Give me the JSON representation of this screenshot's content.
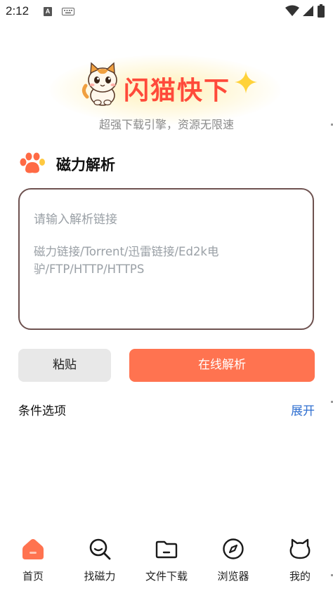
{
  "status_bar": {
    "time": "2:12",
    "input_badge": "A"
  },
  "app": {
    "title": "闪猫快下",
    "tagline": "超强下载引擎，资源无限速"
  },
  "section": {
    "title": "磁力解析"
  },
  "link_input": {
    "placeholder_line1": "请输入解析链接",
    "placeholder_line2": "磁力链接/Torrent/迅雷链接/Ed2k电驴/FTP/HTTP/HTTPS"
  },
  "actions": {
    "paste_label": "粘贴",
    "parse_label": "在线解析"
  },
  "options": {
    "label": "条件选项",
    "expand_label": "展开"
  },
  "bottom_nav": {
    "items": [
      {
        "label": "首页",
        "icon": "home-icon",
        "active": true
      },
      {
        "label": "找磁力",
        "icon": "search-icon",
        "active": false
      },
      {
        "label": "文件下载",
        "icon": "folder-icon",
        "active": false
      },
      {
        "label": "浏览器",
        "icon": "compass-icon",
        "active": false
      },
      {
        "label": "我的",
        "icon": "cat-face-icon",
        "active": false
      }
    ]
  },
  "colors": {
    "accent": "#ff7350",
    "title_red": "#ff4a3a",
    "link_blue": "#2f6fd0",
    "input_border": "#6e5250"
  }
}
